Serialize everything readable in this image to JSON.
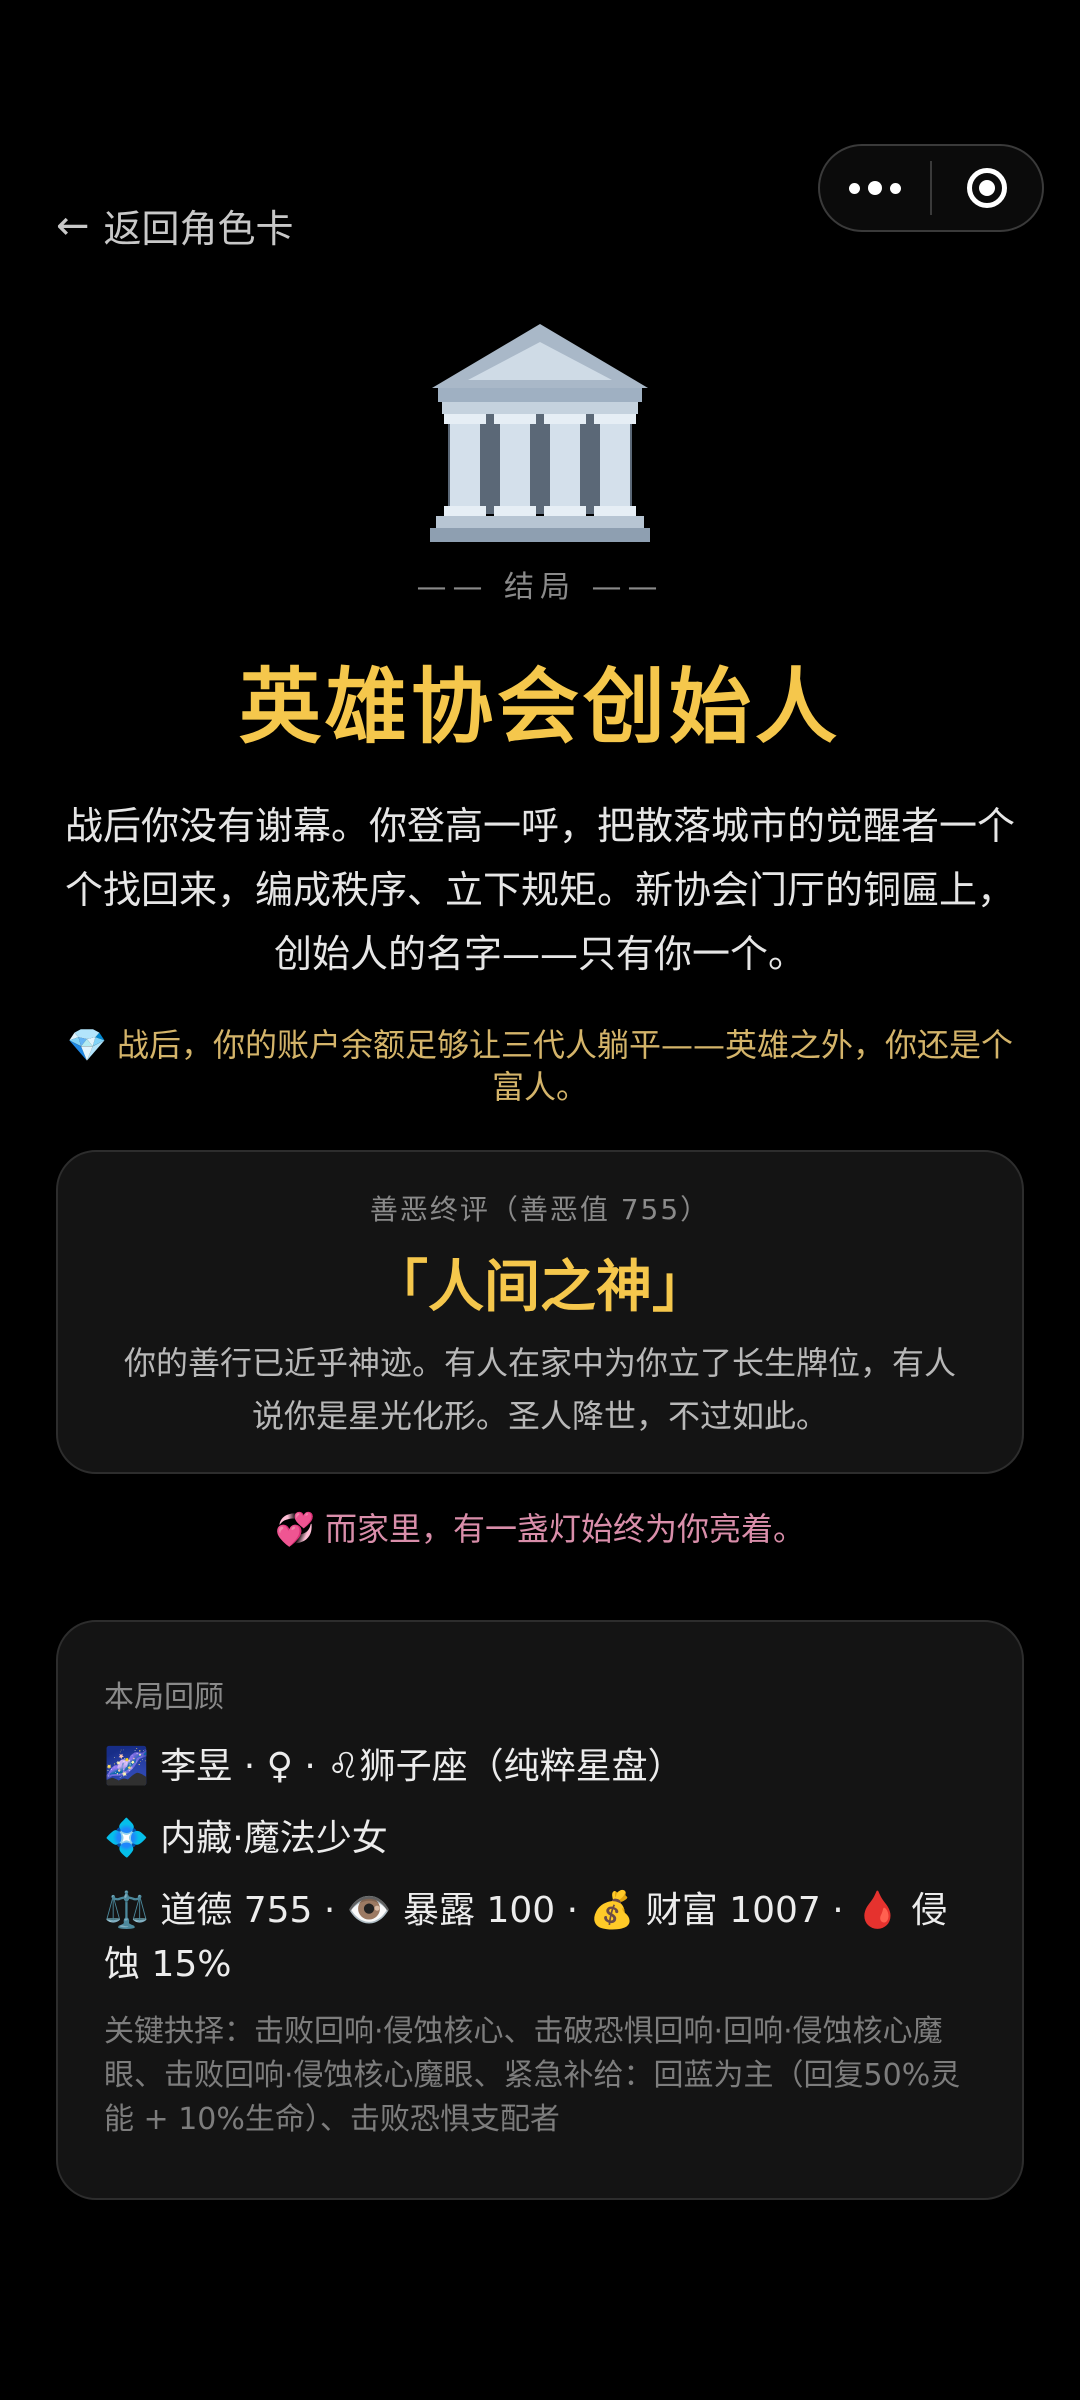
{
  "nav": {
    "back_arrow": "←",
    "back_label": "返回角色卡"
  },
  "capsule": {
    "more_icon": "more-dots-icon",
    "close_icon": "target-circle-icon"
  },
  "ending": {
    "icon": "classical-building-icon",
    "label": "—— 结局 ——",
    "title": "英雄协会创始人",
    "story": "战后你没有谢幕。你登高一呼，把散落城市的觉醒者一个个找回来，编成秩序、立下规矩。新协会门厅的铜匾上，创始人的名字——只有你一个。",
    "wealth_note": "💎 战后，你的账户余额足够让三代人躺平——英雄之外，你还是个富人。"
  },
  "verdict": {
    "caption": "善恶终评（善恶值 755）",
    "name": "「人间之神」",
    "description": "你的善行已近乎神迹。有人在家中为你立了长生牌位，有人说你是星光化形。圣人降世，不过如此。"
  },
  "family_note": "💞 而家里，有一盏灯始终为你亮着。",
  "recap": {
    "heading": "本局回顾",
    "identity": "🌌 李昱 · ♀ · ♌狮子座（纯粹星盘）",
    "talent": "💠 内藏·魔法少女",
    "stats": "⚖️ 道德 755 · 👁️ 暴露 100 · 💰 财富 1007 · 🩸 侵蚀 15%",
    "key_choices": "关键抉择：击败回响·侵蚀核心、击破恐惧回响·回响·侵蚀核心魔眼、击败回响·侵蚀核心魔眼、紧急补给：回蓝为主（回复50%灵能 + 10%生命）、击败恐惧支配者"
  },
  "colors": {
    "background": "#000000",
    "gold": "#f5c74c",
    "wealth_text": "#d4b46a",
    "family_text": "#d98eaa",
    "card_bg": "#141414"
  }
}
